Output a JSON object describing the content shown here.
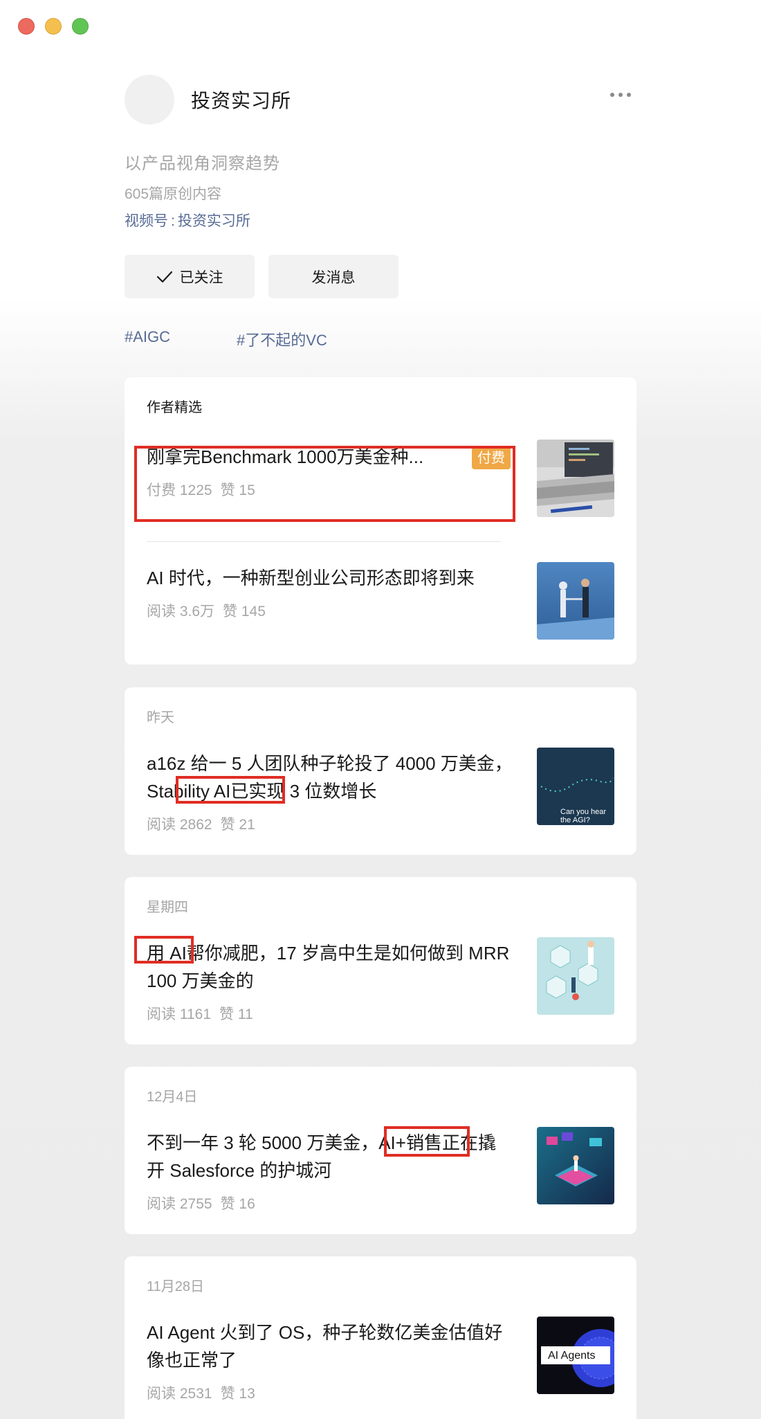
{
  "window": {
    "controls": [
      "close",
      "minimize",
      "zoom"
    ]
  },
  "account": {
    "name": "投资实习所",
    "slogan": "以产品视角洞察趋势",
    "original_count": "605篇原创内容",
    "channel_label": "视频号",
    "channel_sep": ":",
    "channel_name": "投资实习所"
  },
  "buttons": {
    "followed": "已关注",
    "message": "发消息"
  },
  "tags": [
    "#AIGC",
    "#了不起的VC"
  ],
  "featured": {
    "heading": "作者精选",
    "items": [
      {
        "title": "刚拿完Benchmark 1000万美金种...",
        "badge": "付费",
        "stat1": "付费 1225",
        "stat2": "赞 15",
        "thumb": "laptop-image"
      },
      {
        "title": "AI 时代，一种新型创业公司形态即将到来",
        "stat1": "阅读 3.6万",
        "stat2": "赞 145",
        "thumb": "robot-handshake-image"
      }
    ]
  },
  "feed": [
    {
      "date": "昨天",
      "title_pre": "a16z 给一 5 人团队种子轮投了 4000 万美金，",
      "title_hl": "Stability AI",
      "title_post": "已实现 3 位数增长",
      "stat1": "阅读 2862",
      "stat2": "赞 21",
      "thumb_text": [
        "Can you hear",
        "the AGI?"
      ]
    },
    {
      "date": "星期四",
      "title_pre": "",
      "title_hl": "用 AI",
      "title_post": "帮你减肥，17 岁高中生是如何做到 MRR 100 万美金的",
      "stat1": "阅读 1161",
      "stat2": "赞 11"
    },
    {
      "date": "12月4日",
      "title_pre": "不到一年 3 轮 5000 万美金，",
      "title_hl": "AI+销售",
      "title_post": "正在撬开 Salesforce 的护城河",
      "stat1": "阅读 2755",
      "stat2": "赞 16"
    },
    {
      "date": "11月28日",
      "title_pre": "AI Agent 火到了 OS，种子轮数亿美金估值好像也正常了",
      "title_hl": "",
      "title_post": "",
      "stat1": "阅读 2531",
      "stat2": "赞 13",
      "thumb_text": [
        "AI Agents"
      ]
    }
  ],
  "colors": {
    "link": "#576b95",
    "paid_badge": "#f0a846",
    "highlight_box": "#e02d24",
    "muted": "#a6a6a6"
  }
}
